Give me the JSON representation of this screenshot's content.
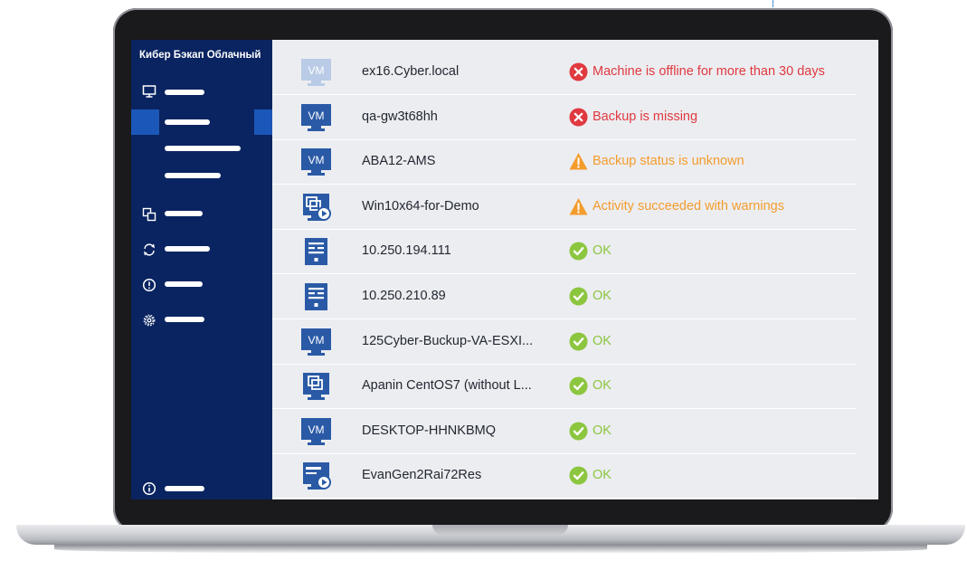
{
  "app": {
    "title": "Кибер Бэкап Облачный"
  },
  "sidebar": {
    "items": [
      {
        "icon": "monitor-icon"
      },
      {
        "icon": "copy-icon"
      },
      {
        "icon": "sync-icon"
      },
      {
        "icon": "alert-icon"
      },
      {
        "icon": "gear-icon"
      },
      {
        "icon": "info-icon"
      }
    ],
    "active_subitem_index": 0
  },
  "colors": {
    "sidebar": "#0a2461",
    "active": "#1b57b8",
    "error": "#e0393f",
    "warning": "#f39c2d",
    "ok": "#8cc63f",
    "device_icon": "#2a5aa6"
  },
  "devices": [
    {
      "name": "ex16.Cyber.local",
      "type": "vm-offline",
      "status": "error",
      "status_text": "Machine is offline for more than 30 days"
    },
    {
      "name": "qa-gw3t68hh",
      "type": "vm",
      "status": "error",
      "status_text": "Backup is missing"
    },
    {
      "name": "ABA12-AMS",
      "type": "vm",
      "status": "warning",
      "status_text": "Backup status is unknown"
    },
    {
      "name": "Win10x64-for-Demo",
      "type": "multi-vm-play",
      "status": "warning",
      "status_text": "Activity succeeded with warnings"
    },
    {
      "name": "10.250.194.111",
      "type": "server",
      "status": "ok",
      "status_text": "OK"
    },
    {
      "name": "10.250.210.89",
      "type": "server",
      "status": "ok",
      "status_text": "OK"
    },
    {
      "name": "125Cyber-Buckup-VA-ESXI...",
      "type": "vm",
      "status": "ok",
      "status_text": "OK"
    },
    {
      "name": "Apanin CentOS7 (without L...",
      "type": "multi-vm",
      "status": "ok",
      "status_text": "OK"
    },
    {
      "name": "DESKTOP-HHNKBMQ",
      "type": "vm",
      "status": "ok",
      "status_text": "OK"
    },
    {
      "name": "EvanGen2Rai72Res",
      "type": "hyperv-play",
      "status": "ok",
      "status_text": "OK"
    }
  ]
}
